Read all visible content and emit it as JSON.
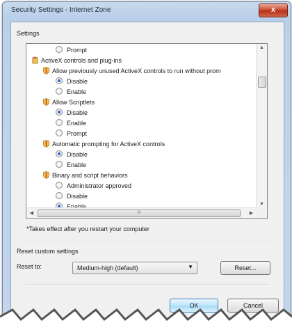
{
  "window": {
    "title": "Security Settings - Internet Zone",
    "close_glyph": "x"
  },
  "settings": {
    "group_label": "Settings",
    "items": [
      {
        "type": "radio",
        "label": "Prompt",
        "checked": false
      },
      {
        "type": "category",
        "label": "ActiveX controls and plug-ins",
        "icon": "gear-icon"
      },
      {
        "type": "setting",
        "label": "Allow previously unused ActiveX controls to run without prom",
        "icon": "shield-icon"
      },
      {
        "type": "radio",
        "label": "Disable",
        "checked": true
      },
      {
        "type": "radio",
        "label": "Enable",
        "checked": false
      },
      {
        "type": "setting",
        "label": "Allow Scriptlets",
        "icon": "shield-icon"
      },
      {
        "type": "radio",
        "label": "Disable",
        "checked": true
      },
      {
        "type": "radio",
        "label": "Enable",
        "checked": false
      },
      {
        "type": "radio",
        "label": "Prompt",
        "checked": false
      },
      {
        "type": "setting",
        "label": "Automatic prompting for ActiveX controls",
        "icon": "shield-icon"
      },
      {
        "type": "radio",
        "label": "Disable",
        "checked": true
      },
      {
        "type": "radio",
        "label": "Enable",
        "checked": false
      },
      {
        "type": "setting",
        "label": "Binary and script behaviors",
        "icon": "shield-icon"
      },
      {
        "type": "radio",
        "label": "Administrator approved",
        "checked": false
      },
      {
        "type": "radio",
        "label": "Disable",
        "checked": false
      },
      {
        "type": "radio",
        "label": "Enable",
        "checked": true
      }
    ],
    "hscroll_thumb_glyph": "III",
    "note": "*Takes effect after you restart your computer"
  },
  "reset": {
    "group_label": "Reset custom settings",
    "reset_to_label": "Reset to:",
    "selected": "Medium-high (default)",
    "reset_button": "Reset..."
  },
  "footer": {
    "ok_button": "OK",
    "cancel_button": "Cancel"
  },
  "colors": {
    "title_bg": "#bdd2ea",
    "close_red": "#c9452c",
    "radio_dot": "#2a64c8",
    "ok_blue": "#a7d9f5"
  }
}
